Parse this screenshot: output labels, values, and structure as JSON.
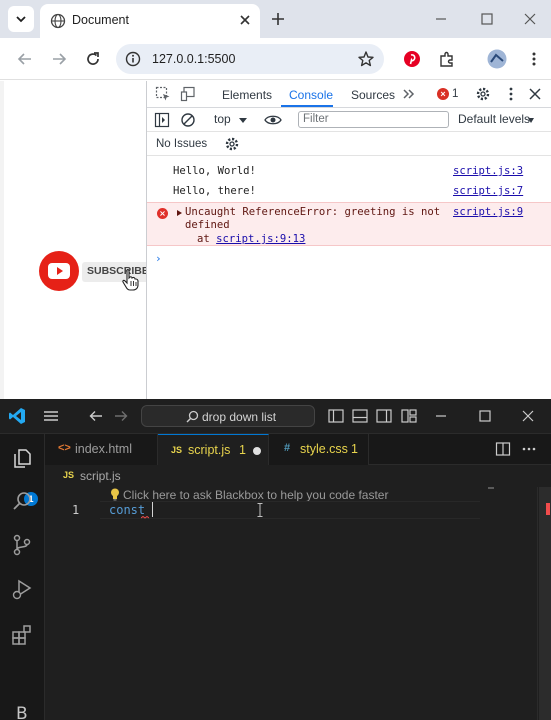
{
  "browser": {
    "tab_title": "Document",
    "url": "127.0.0.1:5500"
  },
  "page": {
    "subscribe_label": "SUBSCRIBED"
  },
  "devtools": {
    "tabs": [
      "Elements",
      "Console",
      "Sources"
    ],
    "active_tab": "Console",
    "error_count": "1",
    "context": "top",
    "filter_placeholder": "Filter",
    "levels": "Default levels",
    "issues": "No Issues",
    "console": [
      {
        "type": "log",
        "message": "Hello, World!",
        "source": "script.js:3"
      },
      {
        "type": "log",
        "message": "Hello, there!",
        "source": "script.js:7"
      },
      {
        "type": "error",
        "message": "Uncaught ReferenceError: greeting is not defined",
        "at_prefix": "at ",
        "at_link": "script.js:9:13",
        "source": "script.js:9"
      }
    ],
    "prompt": "›"
  },
  "vscode": {
    "command_center": "drop down list",
    "activity_b": "B",
    "explorer_badge": "1",
    "tabs": [
      {
        "icon": "<>",
        "label": "index.html",
        "count": ""
      },
      {
        "icon": "JS",
        "label": "script.js",
        "count": "1"
      },
      {
        "icon": "#",
        "label": "style.css",
        "count": "1"
      }
    ],
    "breadcrumb_icon": "JS",
    "breadcrumb": "script.js",
    "hint": "Click here to ask Blackbox to help you code faster",
    "line_number": "1",
    "code": "const "
  },
  "colors": {
    "accent": "#1a73e8",
    "error": "#d93025",
    "vscode_bg": "#1f1f1f",
    "js_yellow": "#e8d44d",
    "subscribe_red": "#e62117"
  }
}
